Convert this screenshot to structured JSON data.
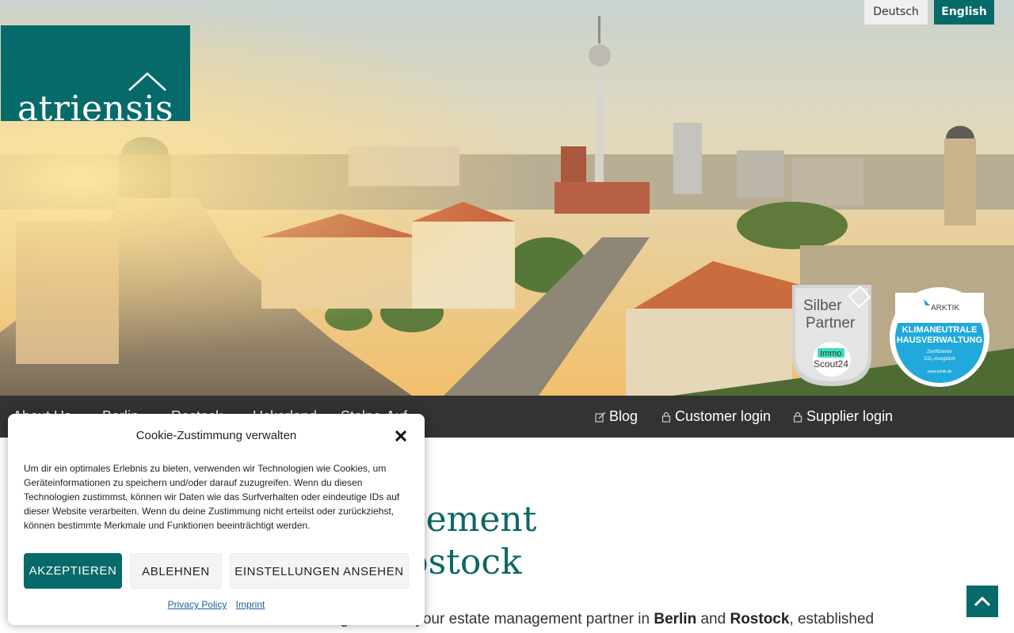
{
  "header": {
    "logo_text": "atriensis",
    "languages": [
      {
        "label": "Deutsch",
        "active": false
      },
      {
        "label": "English",
        "active": true
      }
    ],
    "badges": {
      "silber_line1": "Silber",
      "silber_line2": "Partner",
      "silber_brand_top": "Immo",
      "silber_brand_bottom": "Scout24",
      "arktik_brand": "ARKTIK",
      "arktik_line1": "KLIMANEUTRALE",
      "arktik_line2": "HAUSVERWALTUNG",
      "arktik_line3": "Zertifizierter",
      "arktik_line4": "CO₂-Ausgleich",
      "arktik_url": "www.arktik.de"
    }
  },
  "nav": {
    "left_items": [
      "About Us",
      "Berlin",
      "Rostock",
      "Uckerland",
      "Stolpe-Auf"
    ],
    "right_items": [
      {
        "label": "Blog",
        "icon": "edit-icon"
      },
      {
        "label": "Customer login",
        "icon": "lock-icon"
      },
      {
        "label": "Supplier login",
        "icon": "lock-icon"
      }
    ]
  },
  "main": {
    "heading_line1": "Property management",
    "heading_line2": "in Berlin and Rostock",
    "intro_prefix": "Atriensis Immobilienverwaltung GmbH is your estate management partner in ",
    "intro_city1": "Berlin",
    "intro_and": " and ",
    "intro_city2": "Rostock",
    "intro_suffix": ", established"
  },
  "cookie": {
    "title": "Cookie-Zustimmung verwalten",
    "text": "Um dir ein optimales Erlebnis zu bieten, verwenden wir Technologien wie Cookies, um Geräteinformationen zu speichern und/oder darauf zuzugreifen. Wenn du diesen Technologien zustimmst, können wir Daten wie das Surfverhalten oder eindeutige IDs auf dieser Website verarbeiten. Wenn du deine Zustimmung nicht erteilst oder zurückziehst, können bestimmte Merkmale und Funktionen beeinträchtigt werden.",
    "accept_label": "AKZEPTIEREN",
    "deny_label": "ABLEHNEN",
    "settings_label": "EINSTELLUNGEN ANSEHEN",
    "privacy_link": "Privacy Policy",
    "imprint_link": "Imprint"
  },
  "colors": {
    "brand_teal": "#076a6a",
    "nav_bg": "#333333"
  }
}
